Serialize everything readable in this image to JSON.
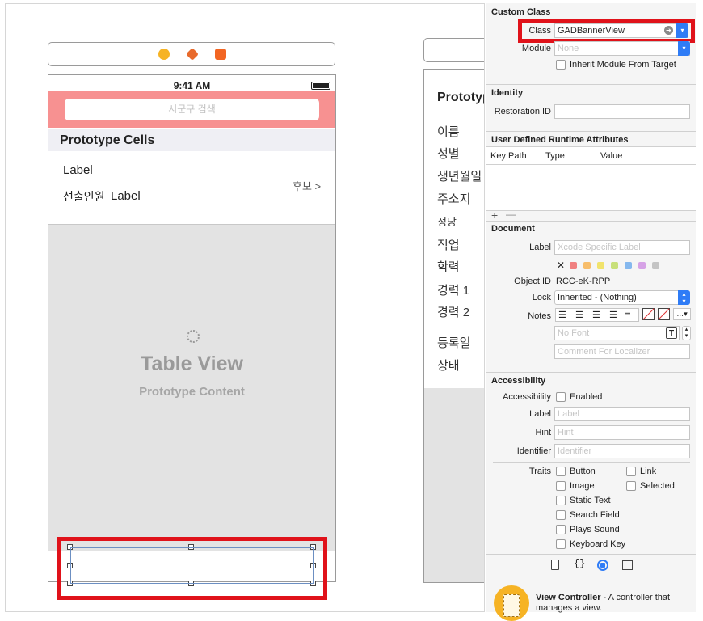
{
  "storyboard": {
    "status_time": "9:41 AM",
    "search_placeholder": "시군구 검색",
    "section_header": "Prototype Cells",
    "cell_label_1": "Label",
    "cell_prefix": "선출인원",
    "cell_label_2": "Label",
    "cell_disclosure": "후보 >",
    "tableview_title": "Table View",
    "tableview_subtitle": "Prototype Content"
  },
  "detail_scene": {
    "title": "Prototyp",
    "labels": [
      "이름",
      "성별",
      "생년월일",
      "주소지",
      "정당",
      "직업",
      "학력",
      "경력 1",
      "경력 2",
      "등록일",
      "상태"
    ]
  },
  "inspector": {
    "custom_class": {
      "title": "Custom Class",
      "class_label": "Class",
      "class_value": "GADBannerView",
      "module_label": "Module",
      "module_placeholder": "None",
      "inherit_label": "Inherit Module From Target"
    },
    "identity": {
      "title": "Identity",
      "restoration_label": "Restoration ID",
      "restoration_value": ""
    },
    "runtime_attrs": {
      "title": "User Defined Runtime Attributes",
      "columns": [
        "Key Path",
        "Type",
        "Value"
      ],
      "add_symbol": "+",
      "remove_symbol": "—"
    },
    "document": {
      "title": "Document",
      "label_label": "Label",
      "label_placeholder": "Xcode Specific Label",
      "object_id_label": "Object ID",
      "object_id_value": "RCC-eK-RPP",
      "lock_label": "Lock",
      "lock_value": "Inherited - (Nothing)",
      "notes_label": "Notes",
      "font_placeholder": "No Font",
      "comment_placeholder": "Comment For Localizer",
      "swatch_colors": [
        "#f08080",
        "#f7bd6a",
        "#f1e36c",
        "#c8e07a",
        "#85b8ee",
        "#d6a2e6",
        "#c4c4c4"
      ]
    },
    "accessibility": {
      "title": "Accessibility",
      "access_label": "Accessibility",
      "enabled_label": "Enabled",
      "label_label": "Label",
      "label_placeholder": "Label",
      "hint_label": "Hint",
      "hint_placeholder": "Hint",
      "identifier_label": "Identifier",
      "identifier_placeholder": "Identifier",
      "traits_label": "Traits",
      "traits_left": [
        "Button",
        "Image",
        "Static Text",
        "Search Field",
        "Plays Sound",
        "Keyboard Key"
      ],
      "traits_right": [
        "Link",
        "Selected"
      ]
    },
    "library": {
      "item_title": "View Controller",
      "item_desc_1": " - A controller that",
      "item_desc_2": "manages a view."
    }
  },
  "accent_color": "#2f7cf6",
  "highlight_color": "#e0121a"
}
